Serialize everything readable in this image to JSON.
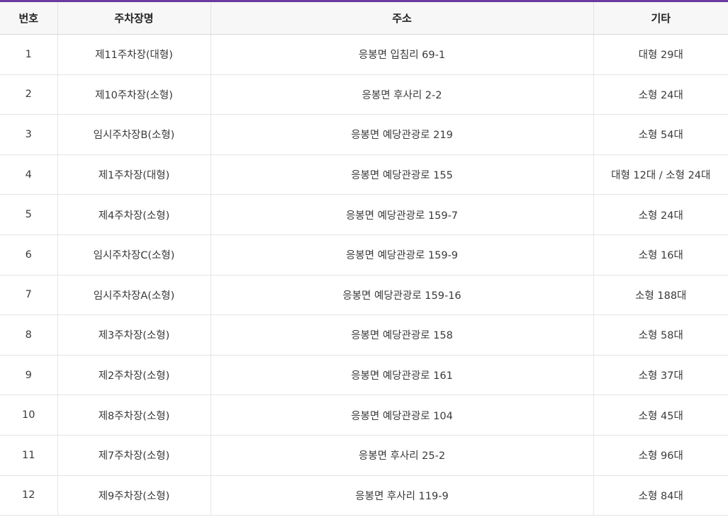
{
  "table": {
    "headers": [
      "번호",
      "주차장명",
      "주소",
      "기타"
    ],
    "rows": [
      {
        "no": "1",
        "name": "제11주차장(대형)",
        "address": "응봉면 입침리 69-1",
        "etc": "대형 29대"
      },
      {
        "no": "2",
        "name": "제10주차장(소형)",
        "address": "응봉면 후사리 2-2",
        "etc": "소형 24대"
      },
      {
        "no": "3",
        "name": "임시주차장B(소형)",
        "address": "응봉면 예당관광로 219",
        "etc": "소형 54대"
      },
      {
        "no": "4",
        "name": "제1주차장(대형)",
        "address": "응봉면 예당관광로 155",
        "etc": "대형 12대 / 소형 24대"
      },
      {
        "no": "5",
        "name": "제4주차장(소형)",
        "address": "응봉면 예당관광로 159-7",
        "etc": "소형 24대"
      },
      {
        "no": "6",
        "name": "임시주차장C(소형)",
        "address": "응봉면 예당관광로 159-9",
        "etc": "소형 16대"
      },
      {
        "no": "7",
        "name": "임시주차장A(소형)",
        "address": "응봉면 예당관광로 159-16",
        "etc": "소형 188대"
      },
      {
        "no": "8",
        "name": "제3주차장(소형)",
        "address": "응봉면 예당관광로 158",
        "etc": "소형 58대"
      },
      {
        "no": "9",
        "name": "제2주차장(소형)",
        "address": "응봉면 예당관광로 161",
        "etc": "소형 37대"
      },
      {
        "no": "10",
        "name": "제8주차장(소형)",
        "address": "응봉면 예당관광로 104",
        "etc": "소형 45대"
      },
      {
        "no": "11",
        "name": "제7주차장(소형)",
        "address": "응봉면 후사리 25-2",
        "etc": "소형 96대"
      },
      {
        "no": "12",
        "name": "제9주차장(소형)",
        "address": "응봉면 후사리 119-9",
        "etc": "소형 84대"
      }
    ]
  },
  "colors": {
    "accent_border": "#6a3aa0",
    "header_bg": "#f7f7f7"
  }
}
